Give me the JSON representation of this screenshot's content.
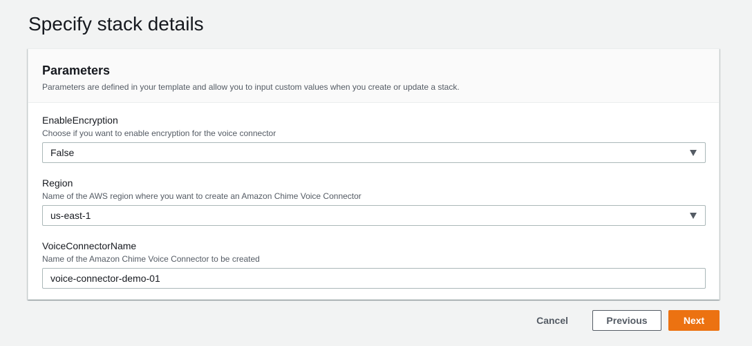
{
  "page": {
    "title": "Specify stack details"
  },
  "parameters": {
    "title": "Parameters",
    "description": "Parameters are defined in your template and allow you to input custom values when you create or update a stack.",
    "fields": [
      {
        "label": "EnableEncryption",
        "description": "Choose if you want to enable encryption for the voice connector",
        "type": "select",
        "value": "False"
      },
      {
        "label": "Region",
        "description": "Name of the AWS region where you want to create an Amazon Chime Voice Connector",
        "type": "select",
        "value": "us-east-1"
      },
      {
        "label": "VoiceConnectorName",
        "description": "Name of the Amazon Chime Voice Connector to be created",
        "type": "text",
        "value": "voice-connector-demo-01"
      }
    ]
  },
  "footer": {
    "cancel_label": "Cancel",
    "previous_label": "Previous",
    "next_label": "Next"
  },
  "colors": {
    "accent": "#ec7211",
    "background": "#f2f3f3",
    "text": "#16191f",
    "secondary_text": "#545b64"
  }
}
